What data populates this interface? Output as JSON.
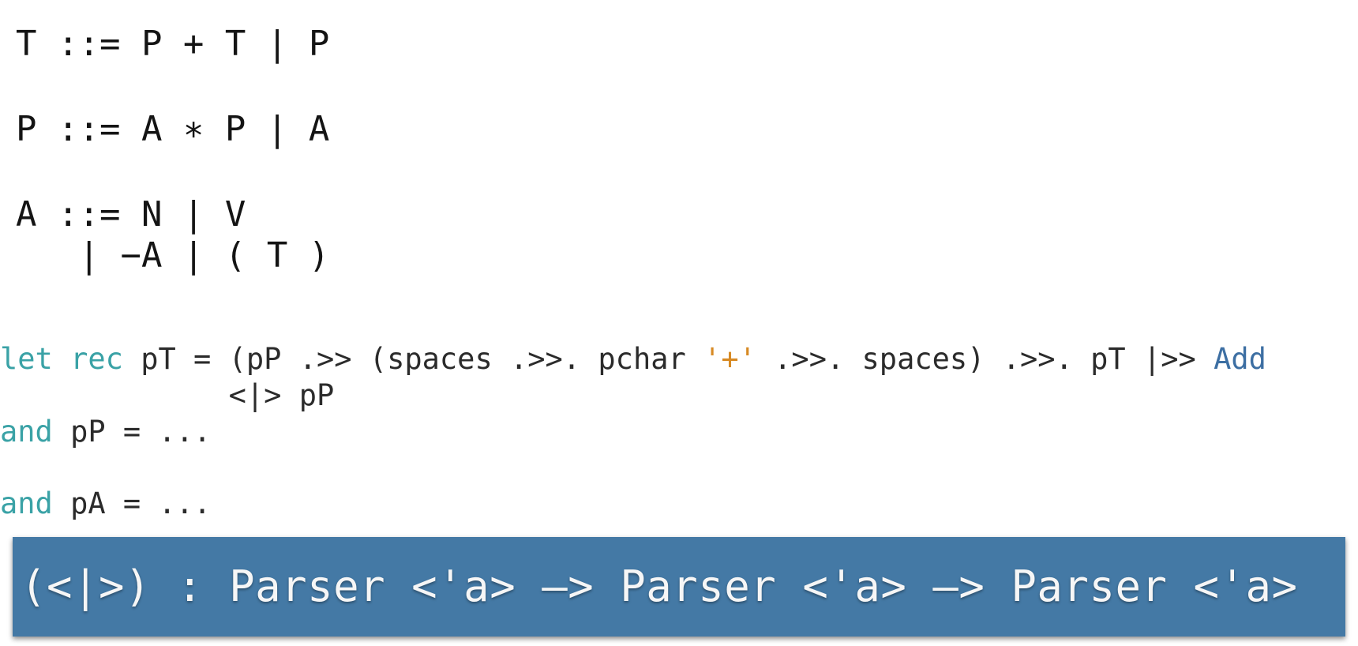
{
  "grammar": {
    "rule_t": "T ::= P + T | P",
    "rule_p": "P ::= A ∗ P | A",
    "rule_a_line1": "A ::= N | V",
    "rule_a_line2": "   | −A | ( T )"
  },
  "code": {
    "line1": {
      "kw_let": "let",
      "kw_rec": "rec",
      "text_a": " pT = (pP .>> (spaces .>>. pchar ",
      "char_plus": "'+'",
      "text_b": " .>>. spaces) .>>. pT |>> ",
      "ctor_add": "Add"
    },
    "line2": "             <|> pP",
    "line3": {
      "kw_and": "and",
      "text": " pP = ..."
    },
    "line4": {
      "kw_and": "and",
      "text": " pA = ..."
    }
  },
  "banner": {
    "signature": "(<|>) : Parser <'a> –> Parser <'a> –> Parser <'a>",
    "background_color": "#4479a5"
  }
}
